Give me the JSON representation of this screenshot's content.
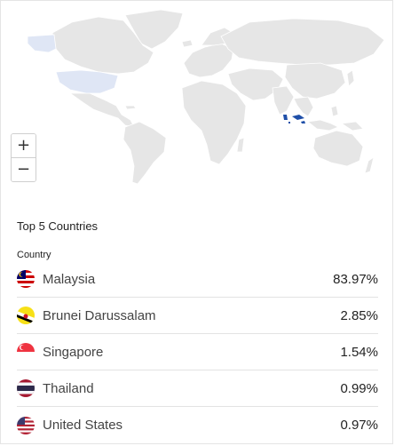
{
  "map": {
    "land_color": "#e6e6e6",
    "highlight_light": "#dfe6f5",
    "highlight_dark": "#1f4fa8",
    "zoom_in_label": "+",
    "zoom_out_label": "−"
  },
  "top_countries": {
    "title": "Top 5 Countries",
    "column_header": "Country",
    "rows": [
      {
        "flag": "malaysia-flag-icon",
        "name": "Malaysia",
        "percent": "83.97%"
      },
      {
        "flag": "brunei-flag-icon",
        "name": "Brunei Darussalam",
        "percent": "2.85%"
      },
      {
        "flag": "singapore-flag-icon",
        "name": "Singapore",
        "percent": "1.54%"
      },
      {
        "flag": "thailand-flag-icon",
        "name": "Thailand",
        "percent": "0.99%"
      },
      {
        "flag": "usa-flag-icon",
        "name": "United States",
        "percent": "0.97%"
      }
    ]
  }
}
